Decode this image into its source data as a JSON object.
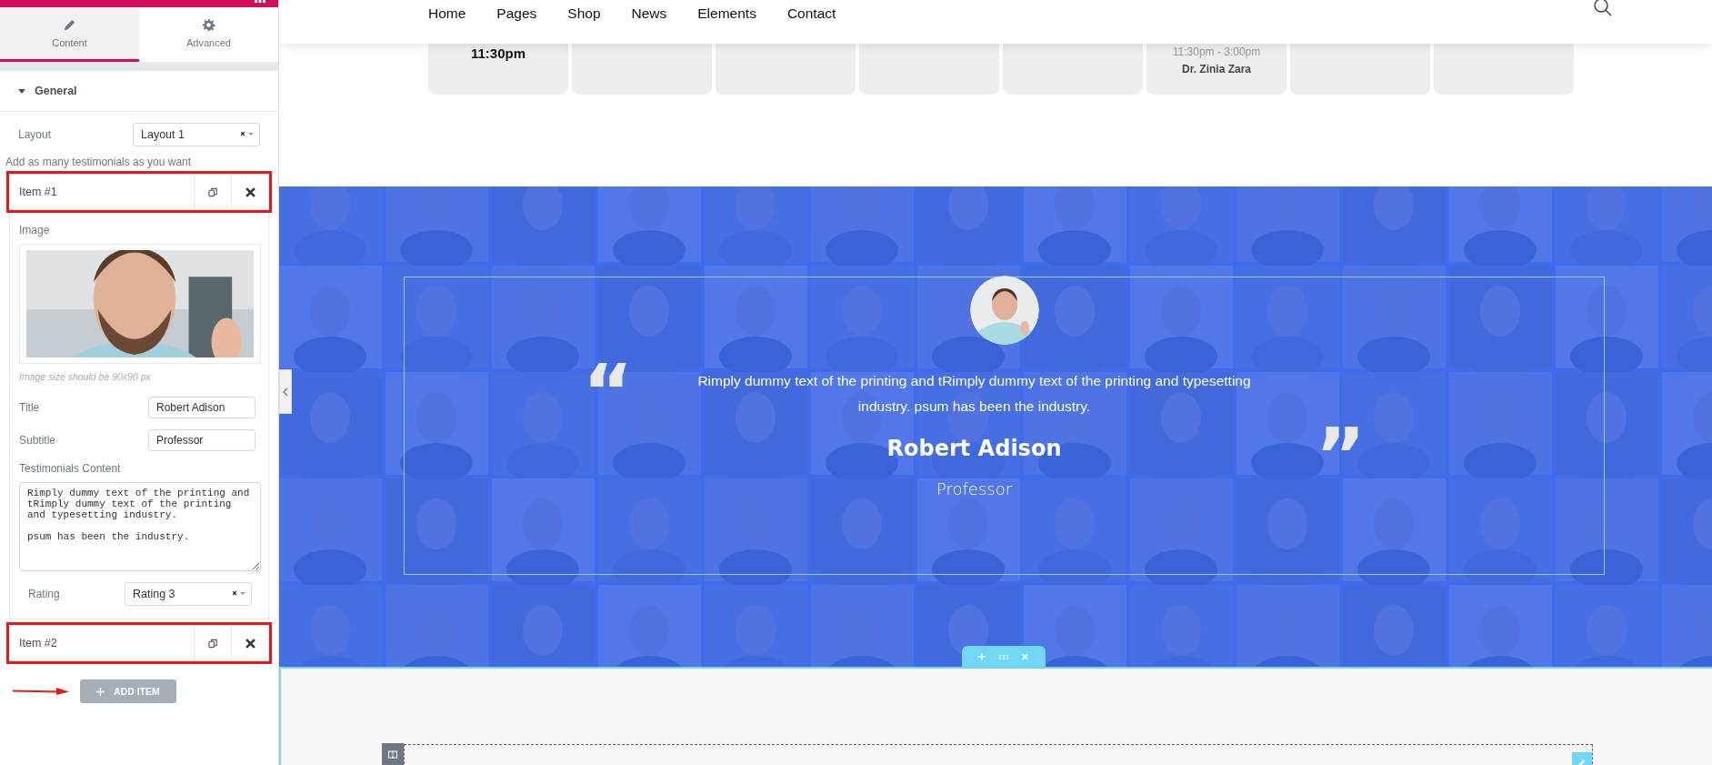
{
  "editor": {
    "tabs": [
      {
        "label": "Content",
        "selected": true
      },
      {
        "label": "Advanced",
        "selected": false
      }
    ],
    "section": {
      "title": "General",
      "expanded": true
    },
    "layout": {
      "label": "Layout",
      "value": "Layout 1"
    },
    "hint": "Add as many testimonials as you want",
    "items": [
      {
        "label": "Item #1",
        "highlighted": true,
        "image_label": "Image",
        "image_note": "Image size should be 90x90 px",
        "fields": [
          {
            "label": "Title",
            "value": "Robert Adison"
          },
          {
            "label": "Subtitle",
            "value": "Professor"
          }
        ],
        "content_label": "Testimonials Content",
        "content": "Rimply dummy text of the printing and tRimply dummy text of the printing and typesetting industry.\n\npsum has been the industry.",
        "rating": {
          "label": "Rating",
          "value": "Rating 3"
        }
      },
      {
        "label": "Item #2",
        "highlighted": true
      }
    ],
    "add_button": "ADD ITEM"
  },
  "page": {
    "nav": [
      {
        "label": "Home"
      },
      {
        "label": "Pages"
      },
      {
        "label": "Shop"
      },
      {
        "label": "News"
      },
      {
        "label": "Elements"
      },
      {
        "label": "Contact"
      }
    ],
    "schedule": [
      {
        "kind": "time",
        "time": "11:30pm"
      },
      {
        "kind": "blank"
      },
      {
        "kind": "blank"
      },
      {
        "kind": "blank"
      },
      {
        "kind": "blank"
      },
      {
        "kind": "shift",
        "time": "11:30pm - 3:00pm",
        "doctor": "Dr. Zinia Zara"
      },
      {
        "kind": "blank"
      },
      {
        "kind": "blank"
      }
    ],
    "testimonial": {
      "open_quote": "“",
      "close_quote": "”",
      "text": "Rimply dummy text of the printing and tRimply dummy text of the printing and typesetting industry. psum has been the industry.",
      "name": "Robert Adison",
      "role": "Professor"
    }
  }
}
